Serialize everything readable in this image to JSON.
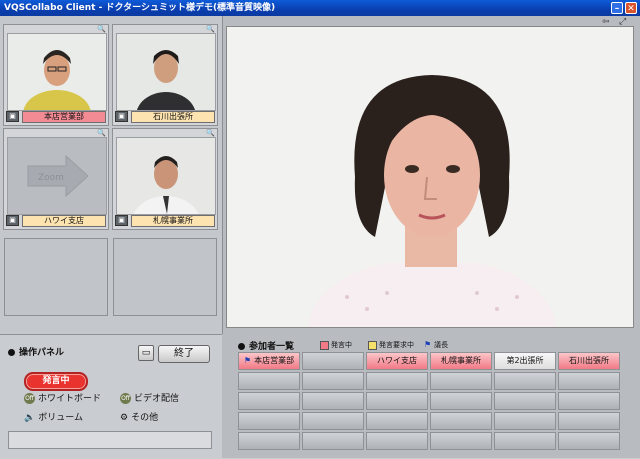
{
  "window": {
    "title": "VQSCollabo Client - ドクターシュミット様デモ(標準音質映像)",
    "minimize_icon": "minimize-icon",
    "close_icon": "close-icon"
  },
  "video_slots": [
    {
      "label": "本店営業部",
      "status": "speaking",
      "has_video": true
    },
    {
      "label": "石川出張所",
      "status": "normal",
      "has_video": true
    },
    {
      "label": "ハワイ支店",
      "status": "normal",
      "has_video": false,
      "placeholder_text": "Zoom"
    },
    {
      "label": "札幌事業所",
      "status": "normal",
      "has_video": true
    }
  ],
  "main_video": {
    "controls": [
      "back-arrow-icon",
      "expand-icon"
    ]
  },
  "operation_panel": {
    "title": "操作パネル",
    "end_button": "終了",
    "speaking_button": "発言中",
    "whiteboard": {
      "badge": "Off",
      "label": "ホワイトボード"
    },
    "video_share": {
      "badge": "Off",
      "label": "ビデオ配信"
    },
    "volume": {
      "label": "ボリューム"
    },
    "other": {
      "label": "その他"
    }
  },
  "participants": {
    "title": "参加者一覧",
    "legend": [
      {
        "label": "発言中",
        "color": "#f27a86"
      },
      {
        "label": "発言要求中",
        "color": "#f5e06a"
      },
      {
        "label": "議長",
        "color": "#1d3fb5"
      }
    ],
    "row1": [
      {
        "name": "本店営業部",
        "state": "speaking",
        "chair": true
      },
      {
        "name": "",
        "state": "empty"
      },
      {
        "name": "ハワイ支店",
        "state": "speaking"
      },
      {
        "name": "札幌事業所",
        "state": "speaking"
      },
      {
        "name": "第2出張所",
        "state": "named"
      },
      {
        "name": "石川出張所",
        "state": "speaking"
      }
    ],
    "empty_rows": 4
  },
  "colors": {
    "accent_red": "#e8332f",
    "titlebar_blue": "#0a3fb0"
  }
}
